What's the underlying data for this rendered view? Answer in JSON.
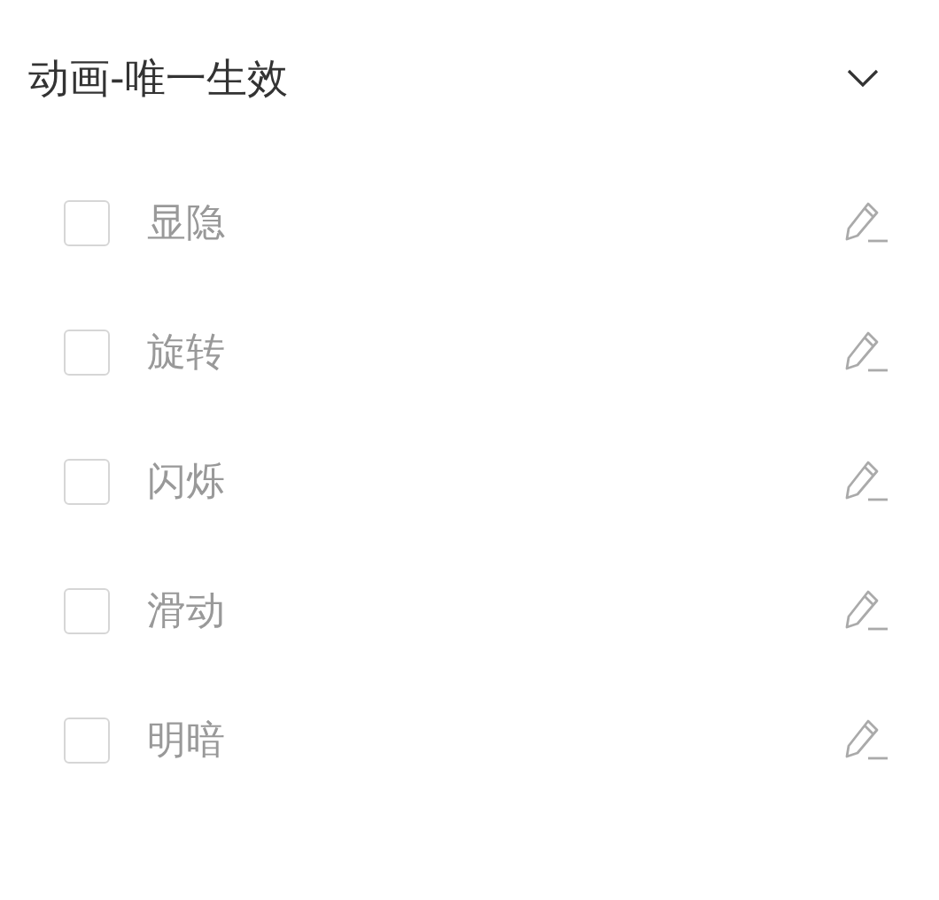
{
  "section": {
    "title": "动画-唯一生效",
    "expanded": true,
    "items": [
      {
        "label": "显隐",
        "checked": false
      },
      {
        "label": "旋转",
        "checked": false
      },
      {
        "label": "闪烁",
        "checked": false
      },
      {
        "label": "滑动",
        "checked": false
      },
      {
        "label": "明暗",
        "checked": false
      }
    ]
  }
}
